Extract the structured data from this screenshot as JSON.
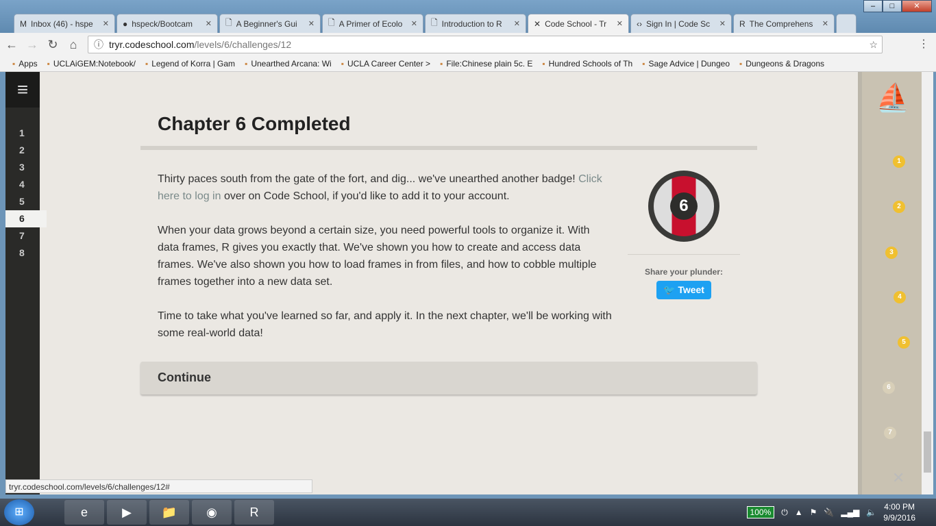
{
  "browser": {
    "tabs": [
      {
        "label": "Inbox (46) - hspe",
        "icon": "gmail-icon"
      },
      {
        "label": "hspeck/Bootcam",
        "icon": "github-icon"
      },
      {
        "label": "A Beginner's Gui",
        "icon": "page-icon"
      },
      {
        "label": "A Primer of Ecolo",
        "icon": "page-icon"
      },
      {
        "label": "Introduction to R",
        "icon": "page-icon"
      },
      {
        "label": "Code School - Tr",
        "icon": "codeschool-icon",
        "active": true
      },
      {
        "label": "Sign In | Code Sc",
        "icon": "code-icon"
      },
      {
        "label": "The Comprehens",
        "icon": "r-icon"
      }
    ],
    "url_host": "tryr.codeschool.com",
    "url_path": "/levels/6/challenges/12",
    "bookmarks": [
      "Apps",
      "UCLAiGEM:Notebook/",
      "Legend of Korra | Gam",
      "Unearthed Arcana: Wi",
      "UCLA Career Center >",
      "File:Chinese plain 5c. E",
      "Hundred Schools of Th",
      "Sage Advice | Dungeo",
      "Dungeons & Dragons"
    ],
    "status_url": "tryr.codeschool.com/levels/6/challenges/12#"
  },
  "sidebar": {
    "levels": [
      "1",
      "2",
      "3",
      "4",
      "5",
      "6",
      "7",
      "8"
    ],
    "current": "6"
  },
  "content": {
    "title": "Chapter 6 Completed",
    "p1_a": "Thirty paces south from the gate of the fort, and dig... we've unearthed another badge! ",
    "p1_link": "Click here to log in",
    "p1_b": " over on Code School, if you'd like to add it to your account.",
    "p2": "When your data grows beyond a certain size, you need powerful tools to organize it. With data frames, R gives you exactly that. We've shown you how to create and access data frames. We've also shown you how to load frames in from files, and how to cobble multiple frames together into a new data set.",
    "p3": "Time to take what you've learned so far, and apply it. In the next chapter, we'll be working with some real-world data!",
    "badge_number": "6",
    "share_label": "Share your plunder:",
    "tweet_label": "Tweet",
    "continue_label": "Continue"
  },
  "map": {
    "points": [
      "1",
      "2",
      "3",
      "4",
      "5",
      "6",
      "7"
    ],
    "completed": 5
  },
  "taskbar": {
    "battery": "100%",
    "time": "4:00 PM",
    "date": "9/9/2016"
  },
  "colors": {
    "accent_link": "#7a8a8a",
    "tweet": "#1da1f2",
    "badge_red": "#c8102e",
    "map_point": "#f0c030"
  }
}
